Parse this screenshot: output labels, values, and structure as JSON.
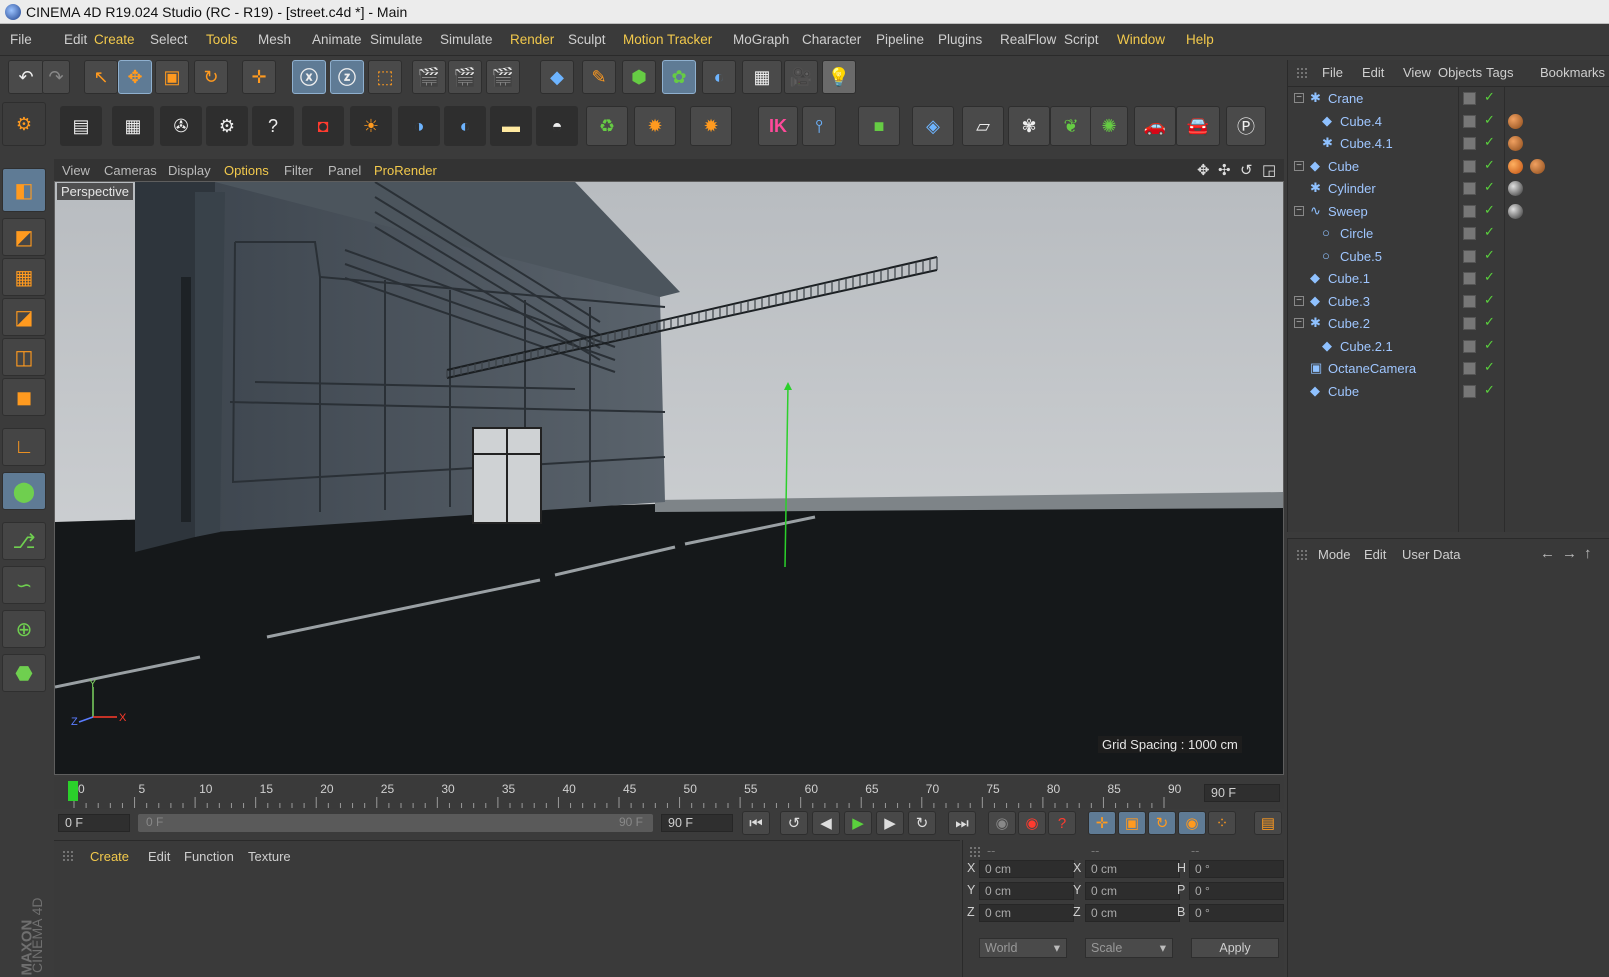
{
  "window": {
    "title": "CINEMA 4D R19.024 Studio (RC - R19) - [street.c4d *] - Main"
  },
  "menu": [
    {
      "label": "File",
      "hl": false
    },
    {
      "label": "Edit",
      "hl": false
    },
    {
      "label": "Create",
      "hl": true
    },
    {
      "label": "Select",
      "hl": false
    },
    {
      "label": "Tools",
      "hl": true
    },
    {
      "label": "Mesh",
      "hl": false
    },
    {
      "label": "Animate",
      "hl": false
    },
    {
      "label": "Simulate",
      "hl": false
    },
    {
      "label": "Simulate",
      "hl": false
    },
    {
      "label": "Render",
      "hl": true
    },
    {
      "label": "Sculpt",
      "hl": false
    },
    {
      "label": "Motion Tracker",
      "hl": true
    },
    {
      "label": "MoGraph",
      "hl": false
    },
    {
      "label": "Character",
      "hl": false
    },
    {
      "label": "Pipeline",
      "hl": false
    },
    {
      "label": "Plugins",
      "hl": false
    },
    {
      "label": "RealFlow",
      "hl": false
    },
    {
      "label": "Script",
      "hl": false
    },
    {
      "label": "Window",
      "hl": true
    },
    {
      "label": "Help",
      "hl": true
    }
  ],
  "viewport": {
    "menu": [
      {
        "label": "View",
        "hl": false
      },
      {
        "label": "Cameras",
        "hl": false
      },
      {
        "label": "Display",
        "hl": false
      },
      {
        "label": "Options",
        "hl": true
      },
      {
        "label": "Filter",
        "hl": false
      },
      {
        "label": "Panel",
        "hl": false
      },
      {
        "label": "ProRender",
        "hl": true
      }
    ],
    "camera_label": "Perspective",
    "grid_spacing": "Grid Spacing : 1000 cm",
    "axis": {
      "x": "X",
      "y": "Y",
      "z": "Z"
    }
  },
  "timeline": {
    "ticks": [
      "0",
      "5",
      "10",
      "15",
      "20",
      "25",
      "30",
      "35",
      "40",
      "45",
      "50",
      "55",
      "60",
      "65",
      "70",
      "75",
      "80",
      "85",
      "90"
    ],
    "end_field": "90 F",
    "current_frame": "0 F",
    "range_start": "0 F",
    "range_end": "90 F",
    "max_field": "90 F"
  },
  "material_panel": {
    "menu": [
      "Create",
      "Edit",
      "Function",
      "Texture"
    ]
  },
  "coordinates": {
    "headers": [
      "--",
      "--",
      "--"
    ],
    "rows": [
      {
        "pos_label": "X",
        "pos": "0 cm",
        "size_label": "X",
        "size": "0 cm",
        "rot_label": "H",
        "rot": "0 °"
      },
      {
        "pos_label": "Y",
        "pos": "0 cm",
        "size_label": "Y",
        "size": "0 cm",
        "rot_label": "P",
        "rot": "0 °"
      },
      {
        "pos_label": "Z",
        "pos": "0 cm",
        "size_label": "Z",
        "size": "0 cm",
        "rot_label": "B",
        "rot": "0 °"
      }
    ],
    "mode": "World",
    "scale": "Scale",
    "apply": "Apply"
  },
  "object_manager": {
    "menu": [
      "File",
      "Edit",
      "View",
      "Objects",
      "Tags",
      "Bookmarks"
    ],
    "objects": [
      {
        "name": "Crane",
        "icon": "null-icon",
        "level": 0,
        "expand": true,
        "tags": []
      },
      {
        "name": "Cube.4",
        "icon": "cube-icon",
        "level": 1,
        "expand": false,
        "tags": [
          "orange"
        ]
      },
      {
        "name": "Cube.4.1",
        "icon": "null-icon",
        "level": 1,
        "expand": false,
        "tags": [
          "orange"
        ]
      },
      {
        "name": "Cube",
        "icon": "cube-icon",
        "level": 0,
        "expand": true,
        "tags": [
          "small-orange",
          "orange"
        ]
      },
      {
        "name": "Cylinder",
        "icon": "null-icon",
        "level": 0,
        "expand": false,
        "tags": [
          "grey"
        ]
      },
      {
        "name": "Sweep",
        "icon": "sweep-icon",
        "level": 0,
        "expand": true,
        "tags": [
          "grey"
        ]
      },
      {
        "name": "Circle",
        "icon": "circle-icon",
        "level": 1,
        "expand": false,
        "tags": []
      },
      {
        "name": "Cube.5",
        "icon": "circle-icon",
        "level": 1,
        "expand": false,
        "tags": []
      },
      {
        "name": "Cube.1",
        "icon": "cube-icon",
        "level": 0,
        "expand": false,
        "tags": []
      },
      {
        "name": "Cube.3",
        "icon": "cube-icon",
        "level": 0,
        "expand": true,
        "tags": []
      },
      {
        "name": "Cube.2",
        "icon": "null-icon",
        "level": 0,
        "expand": true,
        "tags": []
      },
      {
        "name": "Cube.2.1",
        "icon": "cube-icon",
        "level": 1,
        "expand": false,
        "tags": []
      },
      {
        "name": "OctaneCamera",
        "icon": "camera-icon",
        "level": 0,
        "expand": false,
        "tags": []
      },
      {
        "name": "Cube",
        "icon": "cube-icon",
        "level": 0,
        "expand": false,
        "tags": []
      }
    ]
  },
  "attribute_manager": {
    "menu": [
      "Mode",
      "Edit",
      "User Data"
    ]
  },
  "brand": {
    "maxon": "MAXON",
    "product": "CINEMA 4D"
  },
  "colors": {
    "accent": "#f2c94c",
    "object_text": "#9fc6ff",
    "timeline_marker": "#2bd02b"
  }
}
